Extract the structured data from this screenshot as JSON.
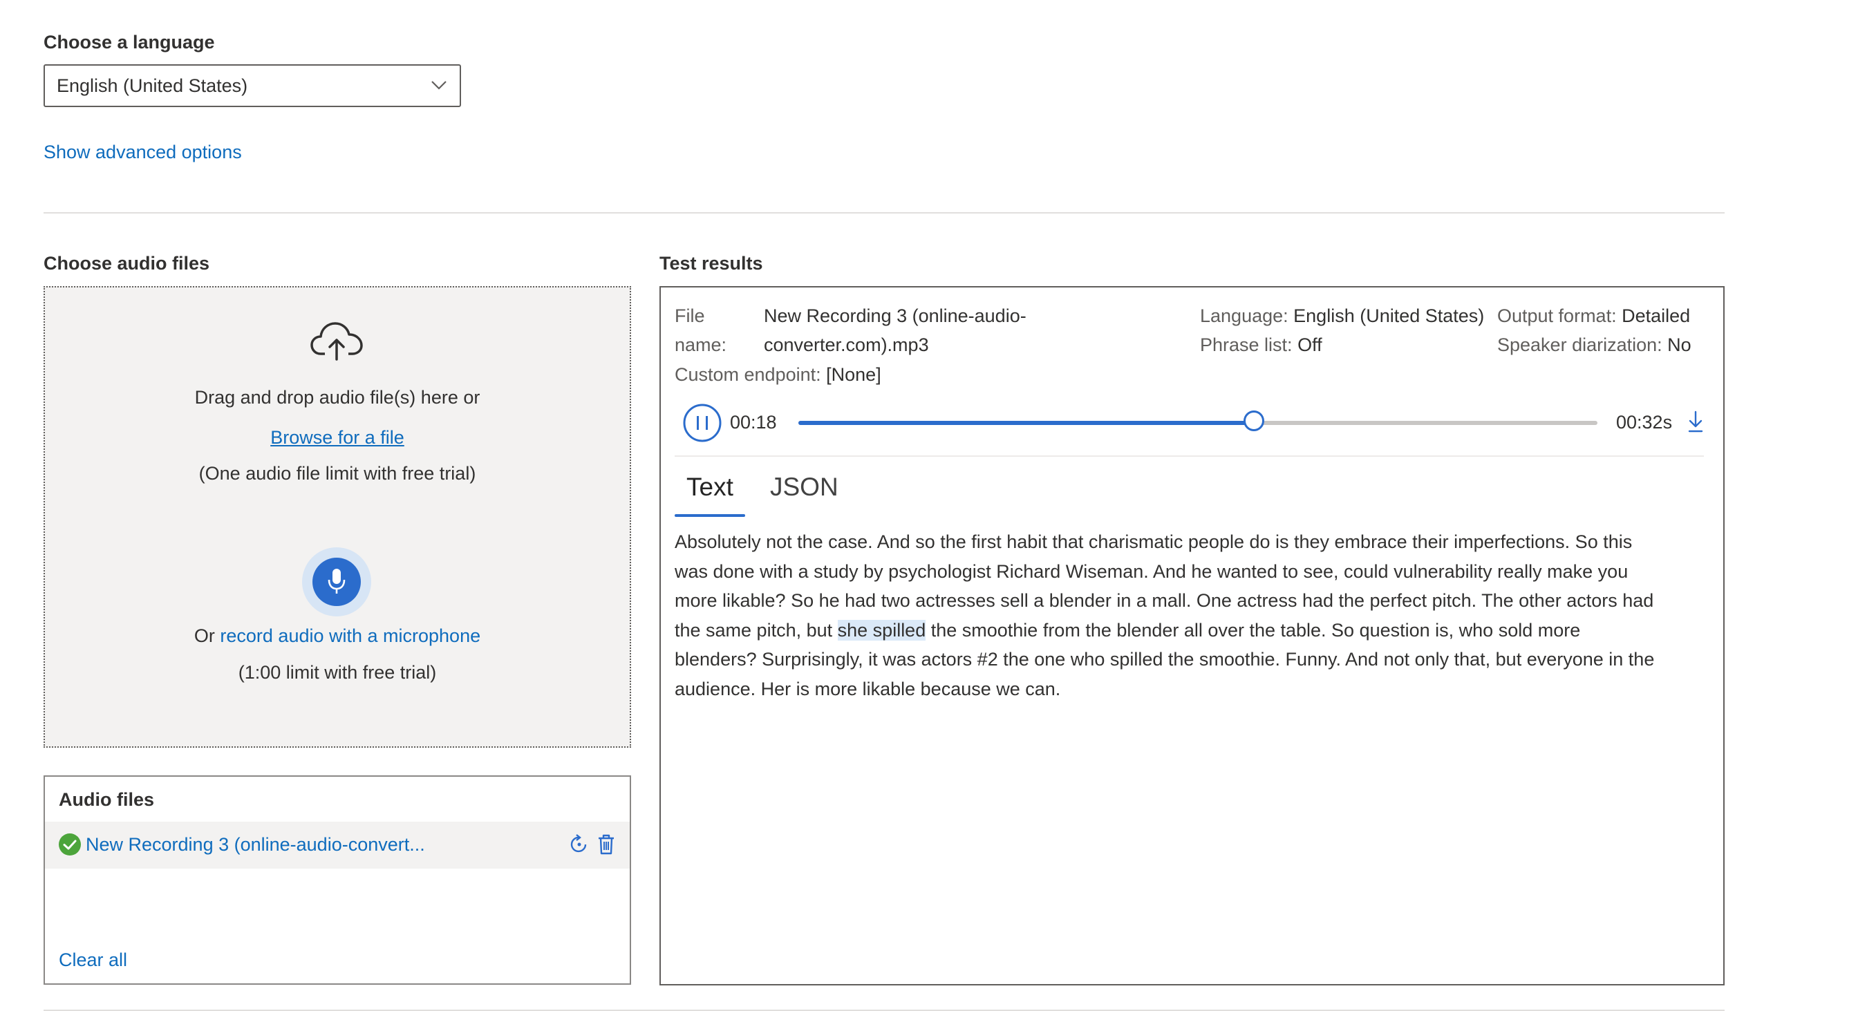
{
  "language": {
    "heading": "Choose a language",
    "selected": "English (United States)",
    "advanced_link": "Show advanced options"
  },
  "audio_input": {
    "heading": "Choose audio files",
    "drag_text": "Drag and drop audio file(s) here or",
    "browse_link": "Browse for a file",
    "file_limit": "(One audio file limit with free trial)",
    "record_prefix": "Or",
    "record_link": "record audio with a microphone",
    "record_limit": "(1:00 limit with free trial)",
    "icons": [
      "cloud-upload-icon",
      "microphone-icon"
    ]
  },
  "audio_files": {
    "heading": "Audio files",
    "items": [
      {
        "name": "New Recording 3 (online-audio-convert...",
        "status": "success"
      }
    ],
    "clear_all": "Clear all",
    "colors": {
      "success": "#4ca43b",
      "accent": "#0f6cbd"
    }
  },
  "results": {
    "heading": "Test results",
    "file_name_label_1": "File",
    "file_name_label_2": "name:",
    "file_name_value_1": "New Recording 3 (online-audio-",
    "file_name_value_2": "converter.com).mp3",
    "language_label": "Language:",
    "language_value": "English (United States)",
    "output_label": "Output format:",
    "output_value": "Detailed",
    "phrase_label": "Phrase list:",
    "phrase_value": "Off",
    "diarization_label": "Speaker diarization:",
    "diarization_value": "No",
    "endpoint_label": "Custom endpoint:",
    "endpoint_value": "[None]",
    "player": {
      "current_time": "00:18",
      "total_time": "00:32s",
      "progress": 0.57
    },
    "tabs": [
      {
        "label": "Text",
        "active": true
      },
      {
        "label": "JSON",
        "active": false
      }
    ],
    "transcript": {
      "lines": [
        "Absolutely not the case. And so the first habit that charismatic people do is they embrace their imperfections. So this",
        "was done with a study by psychologist Richard Wiseman. And he wanted to see, could vulnerability really make you",
        "more likable? So he had two actresses sell a blender in a mall. One actress had the perfect pitch. The other actors had"
      ],
      "line4_before": "the same pitch, but ",
      "line4_highlight": "she spilled",
      "line4_after": " the smoothie from the blender all over the table. So question is, who sold more",
      "lines_end": [
        "blenders? Surprisingly, it was actors #2 the one who spilled the smoothie. Funny. And not only that, but everyone in the",
        "audience. Her is more likable because we can."
      ]
    }
  }
}
